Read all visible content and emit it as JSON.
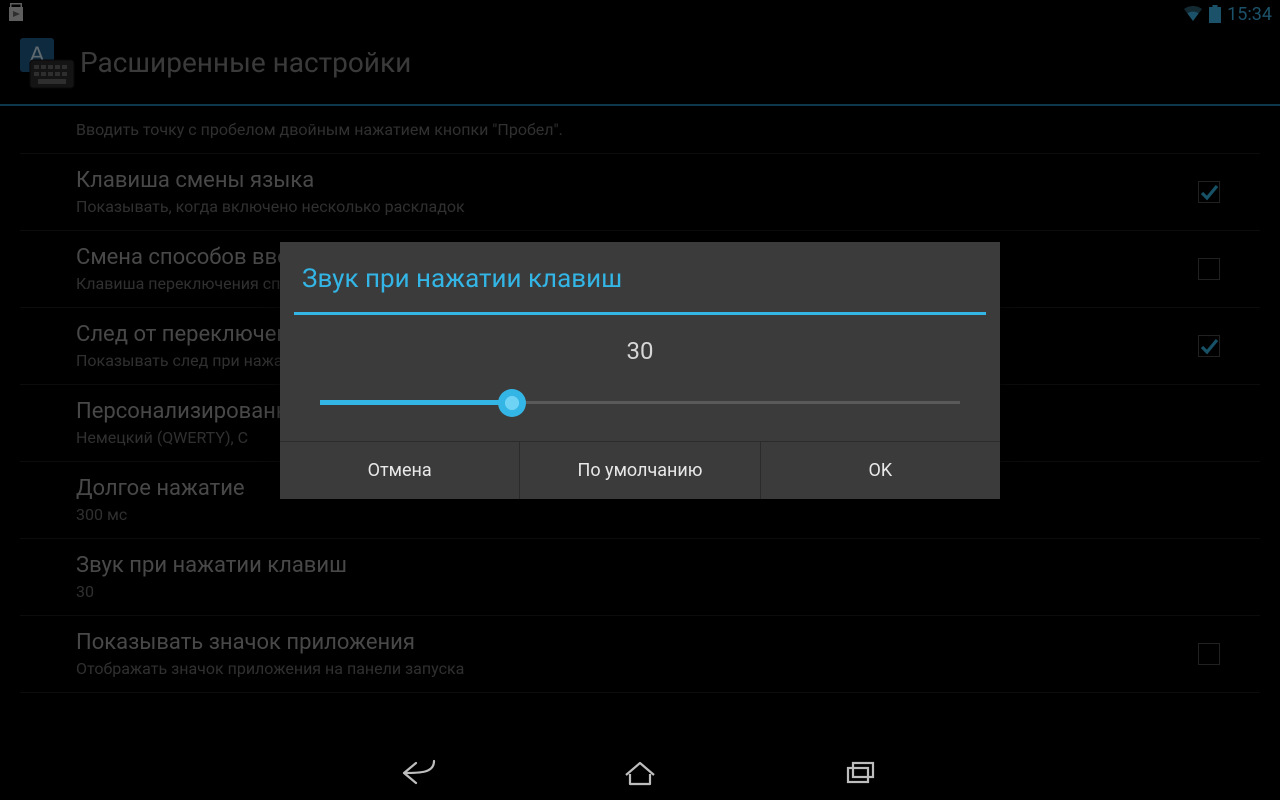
{
  "status_bar": {
    "time": "15:34"
  },
  "header": {
    "title": "Расширенные настройки"
  },
  "settings": [
    {
      "title": "",
      "sub": "Вводить точку с пробелом двойным нажатием кнопки \"Пробел\".",
      "checkbox": null
    },
    {
      "title": "Клавиша смены языка",
      "sub": "Показывать, когда включено несколько раскладок",
      "checkbox": true
    },
    {
      "title": "Смена способов ввода",
      "sub": "Клавиша переключения способов ввода также учитывает и другие способы ввода",
      "checkbox": false
    },
    {
      "title": "След от переключения языка",
      "sub": "Показывать след при нажатии клавиши переключения языка",
      "checkbox": true
    },
    {
      "title": "Персонализированные словари",
      "sub": "Немецкий (QWERTY), С",
      "checkbox": null
    },
    {
      "title": "Долгое нажатие",
      "sub": "300 мс",
      "checkbox": null
    },
    {
      "title": "Звук при нажатии клавиш",
      "sub": "30",
      "checkbox": null
    },
    {
      "title": "Показывать значок приложения",
      "sub": "Отображать значок приложения на панели запуска",
      "checkbox": false
    }
  ],
  "dialog": {
    "title": "Звук при нажатии клавиш",
    "value": "30",
    "slider": {
      "percent": 30
    },
    "buttons": {
      "cancel": "Отмена",
      "default": "По умолчанию",
      "ok": "OK"
    }
  }
}
